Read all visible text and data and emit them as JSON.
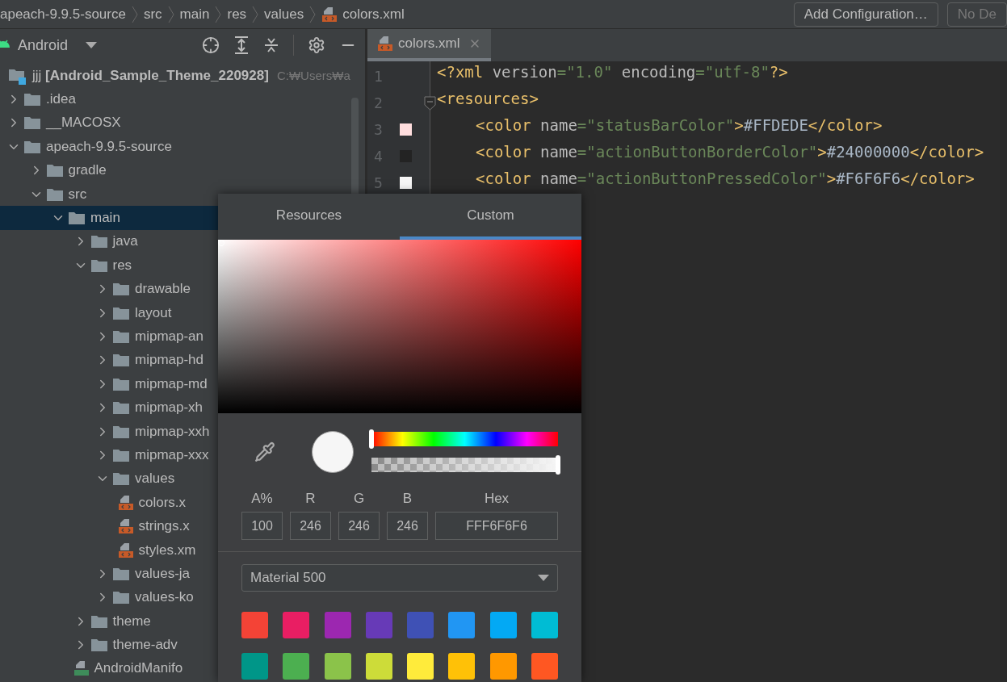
{
  "breadcrumbs": [
    {
      "label": "apeach-9.9.5-source",
      "kind": "folder"
    },
    {
      "label": "src",
      "kind": "folder"
    },
    {
      "label": "main",
      "kind": "folder"
    },
    {
      "label": "res",
      "kind": "folder"
    },
    {
      "label": "values",
      "kind": "folder"
    },
    {
      "label": "colors.xml",
      "kind": "xml"
    }
  ],
  "toolbar_buttons": [
    {
      "label": "Add Configuration…",
      "disabled": false
    },
    {
      "label": "No De",
      "disabled": true
    }
  ],
  "project_view": {
    "label": "Android"
  },
  "tree": [
    {
      "label": "jjj **[Android_Sample_Theme_220928]**",
      "path": "C:₩Users₩a",
      "kind": "module",
      "selected": false,
      "children": [
        {
          "label": ".idea",
          "kind": "folder",
          "expanded": false,
          "selected": false
        },
        {
          "label": "__MACOSX",
          "kind": "folder",
          "expanded": false,
          "selected": false
        },
        {
          "label": "apeach-9.9.5-source",
          "kind": "folder",
          "expanded": true,
          "selected": false,
          "children": [
            {
              "label": "gradle",
              "kind": "folder",
              "expanded": false,
              "selected": false
            },
            {
              "label": "src",
              "kind": "folder",
              "expanded": true,
              "selected": false,
              "children": [
                {
                  "label": "main",
                  "kind": "folder",
                  "expanded": true,
                  "selected": true,
                  "children": [
                    {
                      "label": "java",
                      "kind": "folder",
                      "expanded": false,
                      "selected": false
                    },
                    {
                      "label": "res",
                      "kind": "folder",
                      "expanded": true,
                      "selected": false,
                      "children": [
                        {
                          "label": "drawable",
                          "kind": "folder",
                          "expanded": false,
                          "selected": false
                        },
                        {
                          "label": "layout",
                          "kind": "folder",
                          "expanded": false,
                          "selected": false
                        },
                        {
                          "label": "mipmap-an",
                          "kind": "folder",
                          "expanded": false,
                          "selected": false
                        },
                        {
                          "label": "mipmap-hd",
                          "kind": "folder",
                          "expanded": false,
                          "selected": false
                        },
                        {
                          "label": "mipmap-md",
                          "kind": "folder",
                          "expanded": false,
                          "selected": false
                        },
                        {
                          "label": "mipmap-xh",
                          "kind": "folder",
                          "expanded": false,
                          "selected": false
                        },
                        {
                          "label": "mipmap-xxh",
                          "kind": "folder",
                          "expanded": false,
                          "selected": false
                        },
                        {
                          "label": "mipmap-xxx",
                          "kind": "folder",
                          "expanded": false,
                          "selected": false
                        },
                        {
                          "label": "values",
                          "kind": "folder",
                          "expanded": true,
                          "selected": false,
                          "children": [
                            {
                              "label": "colors.x",
                              "kind": "xml",
                              "selected": false
                            },
                            {
                              "label": "strings.x",
                              "kind": "xml",
                              "selected": false
                            },
                            {
                              "label": "styles.xm",
                              "kind": "xml",
                              "selected": false
                            }
                          ]
                        },
                        {
                          "label": "values-ja",
                          "kind": "folder",
                          "expanded": false,
                          "selected": false
                        },
                        {
                          "label": "values-ko",
                          "kind": "folder",
                          "expanded": false,
                          "selected": false
                        }
                      ]
                    },
                    {
                      "label": "theme",
                      "kind": "folder",
                      "expanded": false,
                      "selected": false
                    },
                    {
                      "label": "theme-adv",
                      "kind": "folder",
                      "expanded": false,
                      "selected": false
                    },
                    {
                      "label": "AndroidManifo",
                      "kind": "manifest",
                      "selected": false
                    }
                  ]
                }
              ]
            }
          ]
        }
      ]
    }
  ],
  "editor_tabs": [
    {
      "label": "colors.xml",
      "selected": true
    }
  ],
  "lines": [
    {
      "number": "1",
      "indent": false,
      "segments": [
        {
          "kind": "tag",
          "text": "<?xml"
        },
        {
          "kind": "attr",
          "text": " version"
        },
        {
          "kind": "string",
          "text": "=\"1.0\""
        },
        {
          "kind": "attr",
          "text": " encoding"
        },
        {
          "kind": "string",
          "text": "=\"utf-8\""
        },
        {
          "kind": "tag",
          "text": "?>"
        }
      ]
    },
    {
      "number": "2",
      "indent": false,
      "fold": true,
      "segments": [
        {
          "kind": "tag",
          "text": "<resources>"
        }
      ]
    },
    {
      "number": "3",
      "indent": true,
      "color": "#ffdede",
      "segments": [
        {
          "kind": "tag",
          "text": "<color"
        },
        {
          "kind": "attr",
          "text": " name"
        },
        {
          "kind": "string",
          "text": "=\"statusBarColor\""
        },
        {
          "kind": "tag",
          "text": ">"
        },
        {
          "kind": "text",
          "text": "#FFDEDE"
        },
        {
          "kind": "tag",
          "text": "</color>"
        }
      ]
    },
    {
      "number": "4",
      "indent": true,
      "color": "#232323",
      "segments": [
        {
          "kind": "tag",
          "text": "<color"
        },
        {
          "kind": "attr",
          "text": " name"
        },
        {
          "kind": "string",
          "text": "=\"actionButtonBorderColor\""
        },
        {
          "kind": "tag",
          "text": ">"
        },
        {
          "kind": "text",
          "text": "#24000000"
        },
        {
          "kind": "tag",
          "text": "</color>"
        }
      ]
    },
    {
      "number": "5",
      "indent": true,
      "color": "#f6f6f6",
      "segments": [
        {
          "kind": "tag",
          "text": "<color"
        },
        {
          "kind": "attr",
          "text": " name"
        },
        {
          "kind": "string",
          "text": "=\"actionButtonPressedColor\""
        },
        {
          "kind": "tag",
          "text": ">"
        },
        {
          "kind": "text",
          "text": "#F6F6F6"
        },
        {
          "kind": "tag",
          "text": "</color>"
        }
      ]
    }
  ],
  "color_picker": {
    "tabs": [
      {
        "label": "Resources",
        "selected": false
      },
      {
        "label": "Custom",
        "selected": true
      }
    ],
    "hue": {
      "level": 0
    },
    "alpha": {
      "level": 1
    },
    "preview": {
      "color": "#f6f6f6"
    },
    "fields": [
      {
        "label": "A%",
        "value": "100",
        "wide": false
      },
      {
        "label": "R",
        "value": "246",
        "wide": false
      },
      {
        "label": "G",
        "value": "246",
        "wide": false
      },
      {
        "label": "B",
        "value": "246",
        "wide": false
      },
      {
        "label": "Hex",
        "value": "FFF6F6F6",
        "wide": true
      }
    ],
    "palette": {
      "label": "Material 500"
    },
    "swatches": [
      {
        "color": "#f44336"
      },
      {
        "color": "#e91e63"
      },
      {
        "color": "#9c27b0"
      },
      {
        "color": "#673ab7"
      },
      {
        "color": "#3f51b5"
      },
      {
        "color": "#2196f3"
      },
      {
        "color": "#03a9f4"
      },
      {
        "color": "#00bcd4"
      },
      {
        "color": "#009688"
      },
      {
        "color": "#4caf50"
      },
      {
        "color": "#8bc34a"
      },
      {
        "color": "#cddc39"
      },
      {
        "color": "#ffeb3b"
      },
      {
        "color": "#ffc107"
      },
      {
        "color": "#ff9800"
      },
      {
        "color": "#ff5722"
      }
    ]
  }
}
